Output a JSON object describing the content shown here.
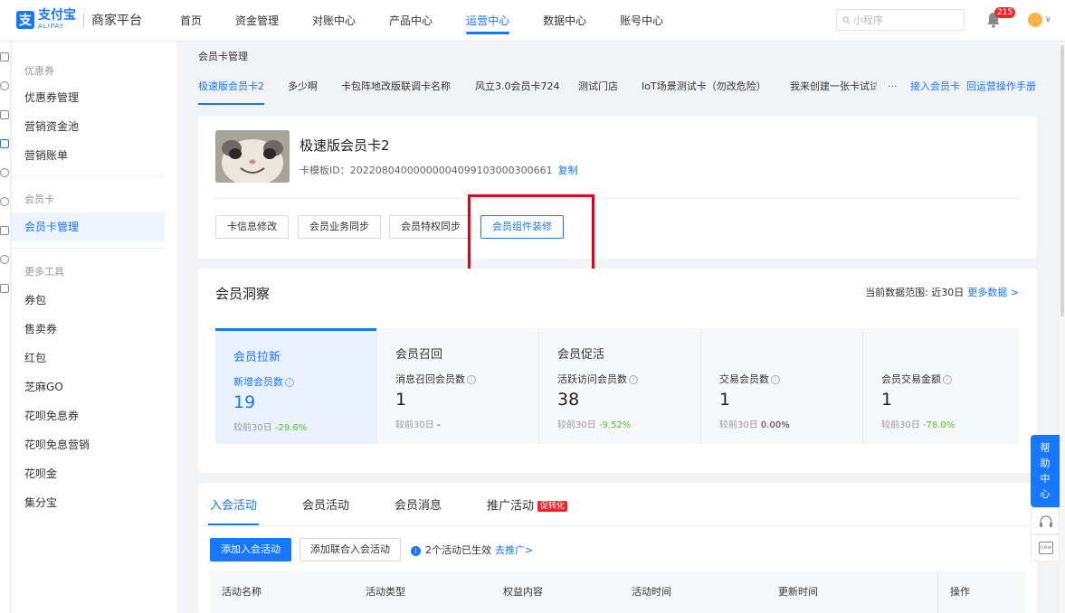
{
  "header": {
    "logo_cn": "支付宝",
    "logo_en": "ALIPAY",
    "platform": "商家平台",
    "nav": [
      "首页",
      "资金管理",
      "对账中心",
      "产品中心",
      "运营中心",
      "数据中心",
      "账号中心"
    ],
    "active_nav": "运营中心",
    "search_placeholder": "小程序",
    "notification_count": "215"
  },
  "sidebar": {
    "group1": "优惠券",
    "group1_items": [
      "优惠券管理",
      "营销资金池",
      "营销账单"
    ],
    "group2": "会员卡",
    "group2_items": [
      "会员卡管理"
    ],
    "group3": "更多工具",
    "group3_items": [
      "券包",
      "售卖券",
      "红包",
      "芝麻GO",
      "花呗免息券",
      "花呗免息营销",
      "花呗金",
      "集分宝"
    ]
  },
  "breadcrumb": "会员卡管理",
  "card_tabs": [
    "极速版会员卡2",
    "多少啊",
    "卡包阵地改版联调卡名称",
    "风立3.0会员卡724",
    "测试门店",
    "IoT场景测试卡（勿改危险）",
    "我来创建一张卡试试"
  ],
  "card_tab_more": "···",
  "card_tab_links": [
    "接入会员卡",
    "回运营操作手册"
  ],
  "card": {
    "title": "极速版会员卡2",
    "template_id": "卡模板ID：2022080400000000409910300030066​1",
    "copy_label": "复制",
    "buttons": [
      "卡信息修改",
      "会员业务同步",
      "会员特权同步",
      "会员组件装修"
    ]
  },
  "insight": {
    "title": "会员洞察",
    "range_label": "当前数据范围: 近30日",
    "more_label": "更多数据 >",
    "metrics": [
      {
        "category": "会员拉新",
        "label": "新增会员数",
        "value": "19",
        "compare_prefix": "较前30日",
        "compare_value": "-29.6%"
      },
      {
        "category": "会员召回",
        "label": "消息召回会员数",
        "value": "1",
        "compare_prefix": "较前30日",
        "compare_value": "-"
      },
      {
        "category": "会员促活",
        "label": "活跃访问会员数",
        "value": "38",
        "compare_prefix": "较前30日",
        "compare_value": "-9.52%"
      },
      {
        "category": "",
        "label": "交易会员数",
        "value": "1",
        "compare_prefix": "较前30日",
        "compare_value": "0.00%"
      },
      {
        "category": "",
        "label": "会员交易金额",
        "value": "1",
        "compare_prefix": "较前30日",
        "compare_value": "-78.0%"
      }
    ]
  },
  "activity": {
    "tabs": [
      "入会活动",
      "会员活动",
      "会员消息",
      "推广活动"
    ],
    "hot_badge": "促转化",
    "primary_button": "添加入会活动",
    "secondary_button": "添加联合入会活动",
    "notice": "2个活动已生效",
    "notice_link": "去推广>",
    "columns": [
      "活动名称",
      "活动类型",
      "权益内容",
      "活动时间",
      "更新时间",
      "操作"
    ]
  },
  "help": {
    "label": "帮助中心",
    "new_label": "new"
  }
}
